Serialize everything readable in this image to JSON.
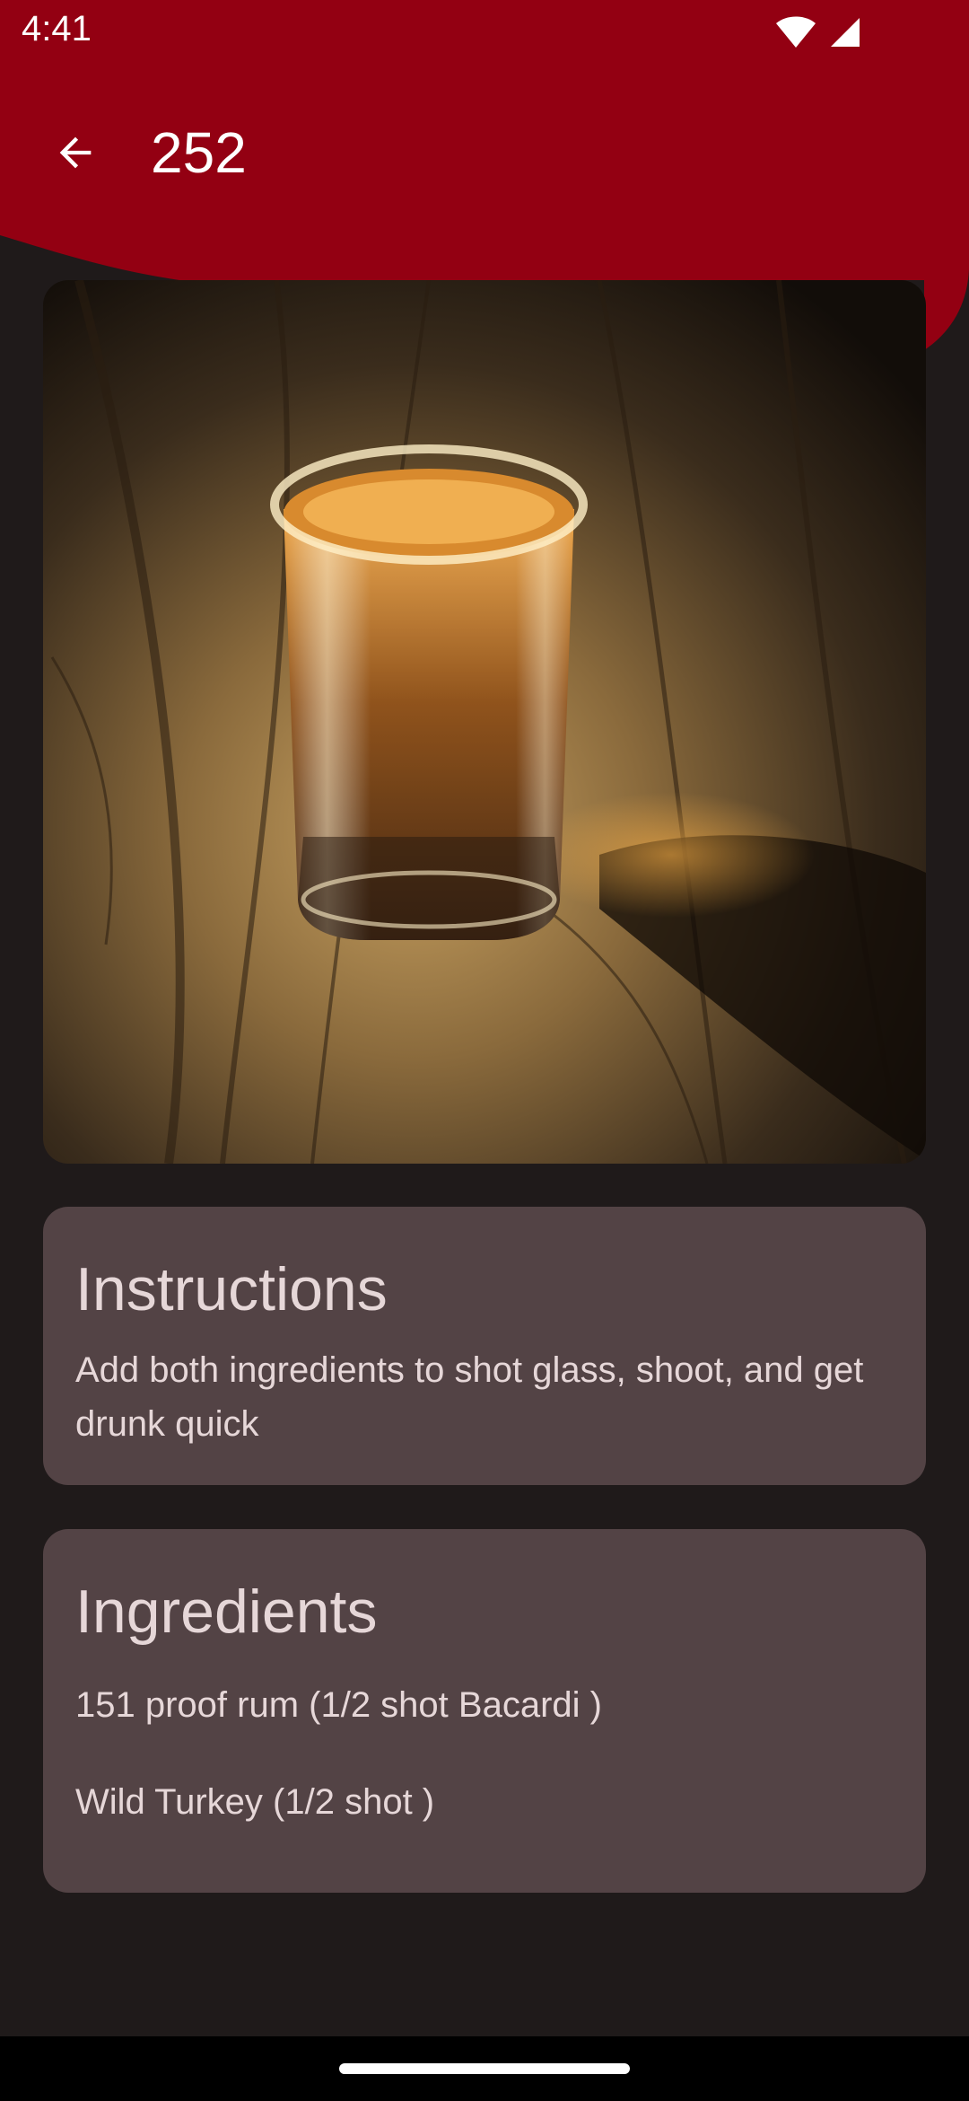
{
  "status_bar": {
    "time": "4:41",
    "icons": [
      "wifi-icon",
      "cellular-signal-icon"
    ]
  },
  "app_bar": {
    "title": "252",
    "back_icon": "arrow-back-icon"
  },
  "hero": {
    "image": "shot-glass-whiskey-photo"
  },
  "instructions": {
    "title": "Instructions",
    "text": "Add both ingredients to shot glass, shoot, and get drunk quick"
  },
  "ingredients": {
    "title": "Ingredients",
    "items": [
      "151 proof rum (1/2 shot Bacardi )",
      "Wild Turkey (1/2 shot )"
    ]
  },
  "colors": {
    "header": "#930012",
    "background": "#1f1a1a",
    "card": "#534345",
    "card_text": "#e6d7d8"
  }
}
